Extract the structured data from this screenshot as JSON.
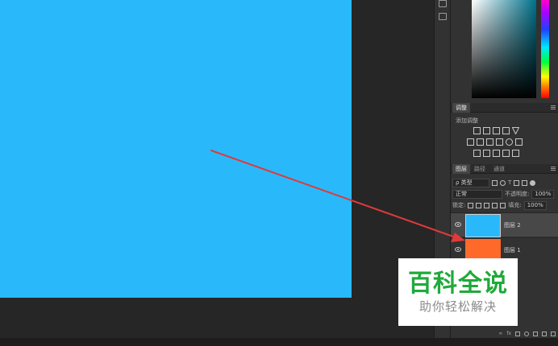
{
  "adjustments_panel": {
    "tab": "调整",
    "subtitle": "添加调整",
    "icons": [
      [
        "brightness-contrast-icon",
        "levels-icon",
        "curves-icon",
        "exposure-icon",
        "vibrance-icon"
      ],
      [
        "hue-saturation-icon",
        "color-balance-icon",
        "black-white-icon",
        "photo-filter-icon",
        "channel-mixer-icon",
        "color-lookup-icon"
      ],
      [
        "invert-icon",
        "posterize-icon",
        "threshold-icon",
        "selective-color-icon",
        "gradient-map-icon"
      ]
    ]
  },
  "layers_panel": {
    "tabs": [
      "图层",
      "路径",
      "通道"
    ],
    "active_tab": "图层",
    "filter_kind": "ρ 类型",
    "blend_mode": "正常",
    "opacity_label": "不透明度:",
    "opacity_value": "100%",
    "lock_label": "锁定:",
    "fill_label": "填充:",
    "fill_value": "100%",
    "layers": [
      {
        "name": "图层 2",
        "color": "#29b9fb",
        "selected": true,
        "visible": true
      },
      {
        "name": "图层 1",
        "color": "#ff6a2a",
        "selected": false,
        "visible": true
      }
    ],
    "footer_link": "fx"
  },
  "canvas": {
    "fill_color": "#29b9fb"
  },
  "watermark": {
    "title": "百科全说",
    "subtitle": "助你轻松解决",
    "title_color": "#1faa3a"
  },
  "annotation": {
    "color": "#e03a3a",
    "icon": "red-arrow-icon"
  }
}
